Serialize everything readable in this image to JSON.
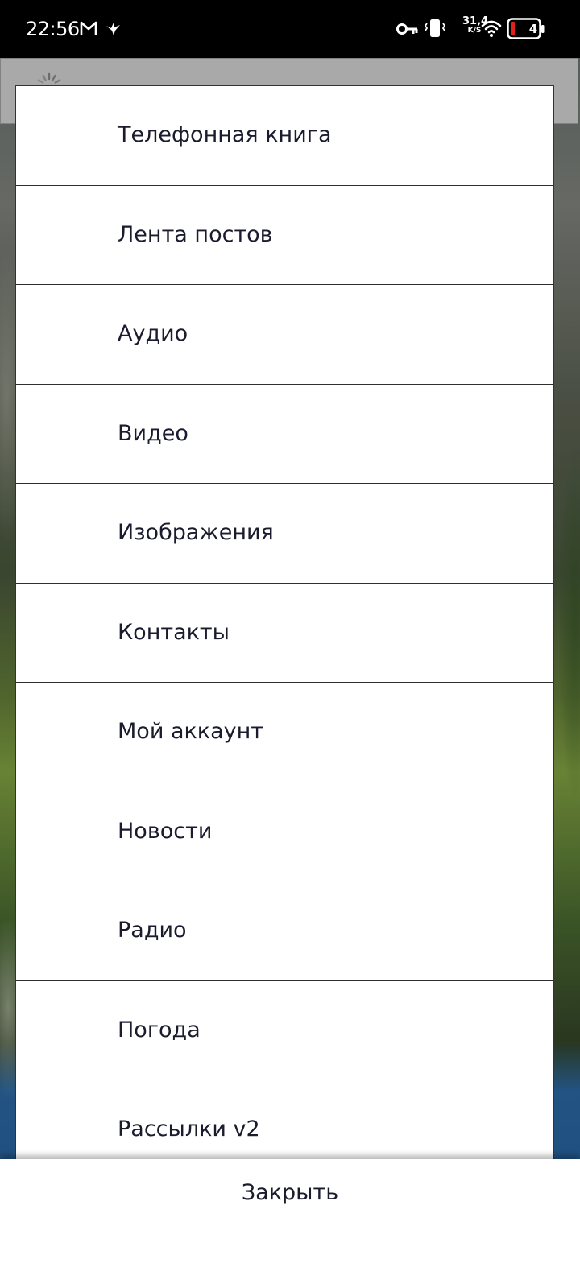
{
  "status_bar": {
    "time": "22:56",
    "net_speed_value": "31,4",
    "net_speed_unit": "K/S",
    "battery_level": "4",
    "icons": [
      "gmail-icon",
      "bird-app-icon",
      "vpn-key-icon",
      "vibrate-icon",
      "wifi-icon",
      "battery-icon"
    ]
  },
  "menu": {
    "items": [
      {
        "label": "Телефонная книга"
      },
      {
        "label": "Лента постов"
      },
      {
        "label": "Аудио"
      },
      {
        "label": "Видео"
      },
      {
        "label": "Изображения"
      },
      {
        "label": "Контакты"
      },
      {
        "label": "Мой аккаунт"
      },
      {
        "label": "Новости"
      },
      {
        "label": "Радио"
      },
      {
        "label": "Погода"
      },
      {
        "label": "Рассылки v2"
      }
    ]
  },
  "close_bar": {
    "close_label": "Закрыть"
  },
  "colors": {
    "status_bar_bg": "#000000",
    "menu_bg": "#ffffff",
    "menu_text": "#1b1b2e",
    "divider": "#2f2f2f",
    "app_header_bg": "#b3b3b3",
    "battery_low": "#e0201a"
  }
}
